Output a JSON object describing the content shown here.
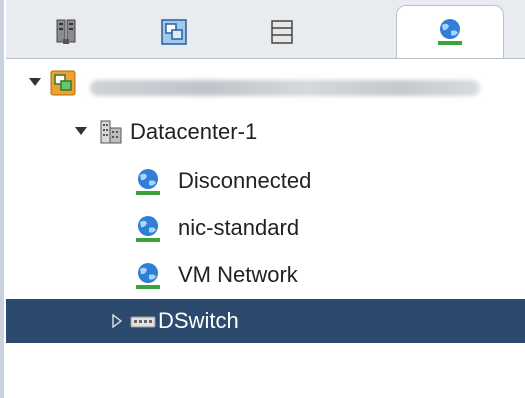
{
  "tabs": [
    {
      "name": "hosts-clusters",
      "icon": "hosts-icon",
      "active": false
    },
    {
      "name": "vms-templates",
      "icon": "vm-templates-icon",
      "active": false
    },
    {
      "name": "storage",
      "icon": "storage-icon",
      "active": false
    },
    {
      "name": "networking",
      "icon": "network-icon",
      "active": true
    }
  ],
  "tree": {
    "vcenter": {
      "label": "",
      "icon": "vcenter-icon",
      "blurred": true
    },
    "datacenter": {
      "label": "Datacenter-1",
      "icon": "datacenter-icon"
    },
    "networks": [
      {
        "label": "Disconnected",
        "icon": "network-icon"
      },
      {
        "label": "nic-standard",
        "icon": "network-icon"
      },
      {
        "label": "VM Network",
        "icon": "network-icon"
      }
    ],
    "dswitch": {
      "label": "DSwitch",
      "icon": "distributed-switch-icon",
      "selected": true
    }
  },
  "colors": {
    "selection": "#2b4a6e",
    "network_blue": "#2f7fd6",
    "network_green": "#3aa33a",
    "vcenter_orange": "#f0a030"
  }
}
